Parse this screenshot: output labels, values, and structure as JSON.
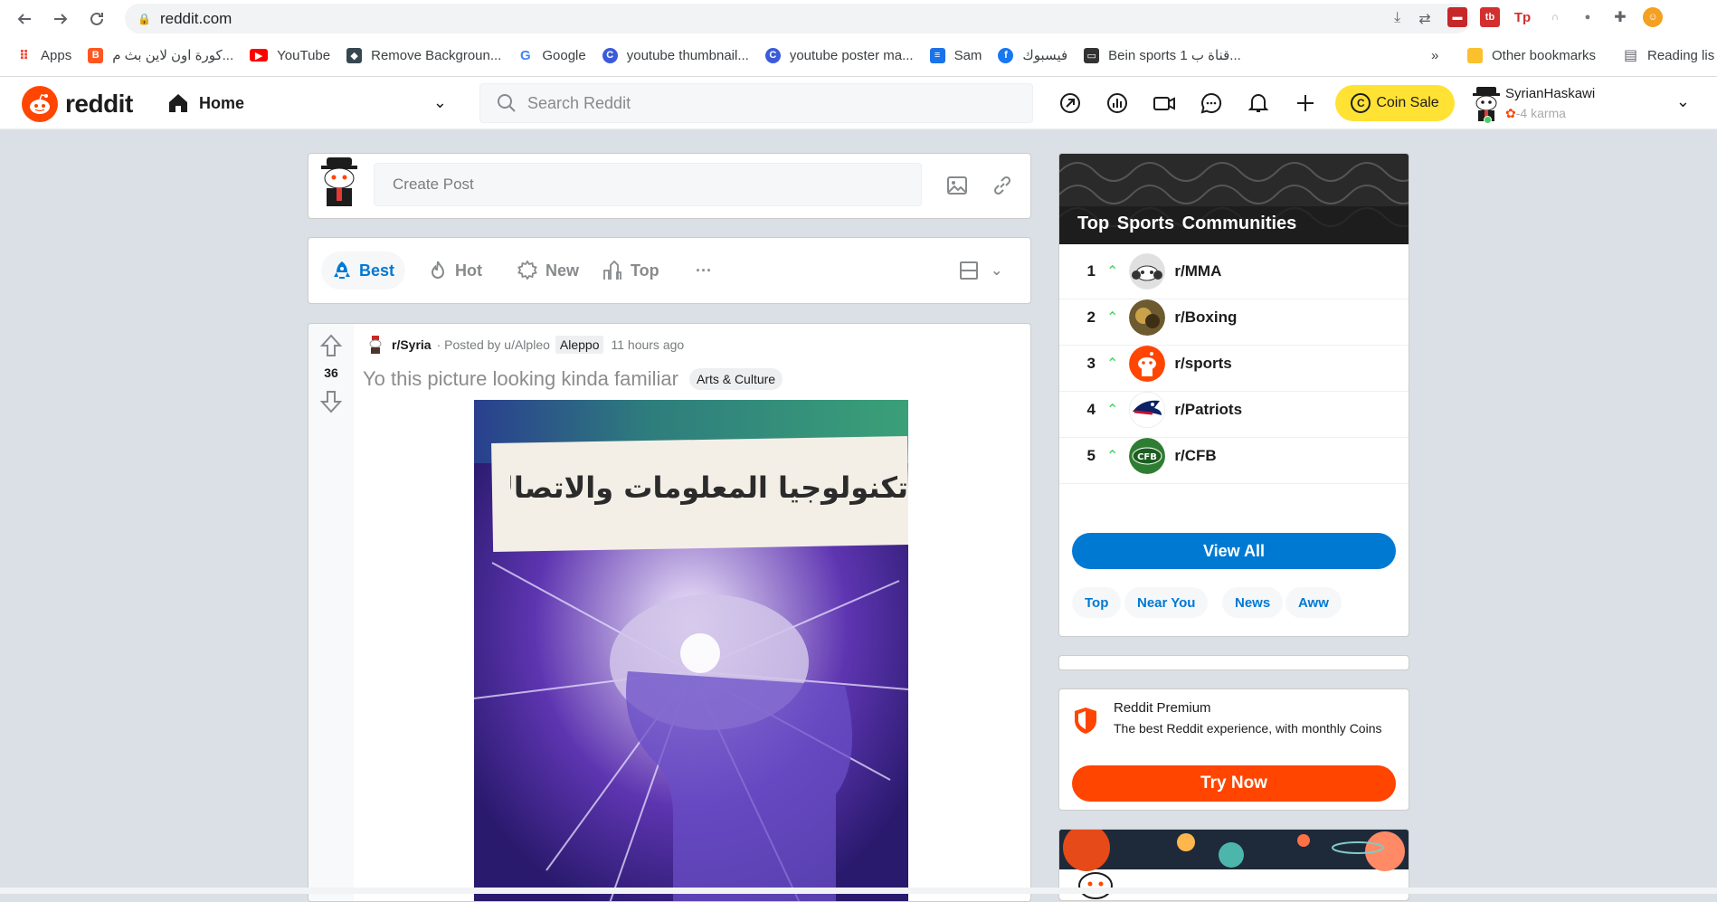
{
  "browser": {
    "url": "reddit.com",
    "bookmarks": [
      {
        "label": "Apps",
        "icon": "apps-grid-icon",
        "color": "#ea4335"
      },
      {
        "label": "كورة اون لاين بث م...",
        "icon": "blogger-icon",
        "color": "#ff5722"
      },
      {
        "label": "YouTube",
        "icon": "youtube-icon",
        "color": "#ff0000"
      },
      {
        "label": "Remove Backgroun...",
        "icon": "removebg-icon",
        "color": "#37474f"
      },
      {
        "label": "Google",
        "icon": "google-icon",
        "color": "#4285f4"
      },
      {
        "label": "youtube thumbnail...",
        "icon": "canva-icon",
        "color": "#3b5bdb"
      },
      {
        "label": "youtube poster ma...",
        "icon": "canva-icon",
        "color": "#3b5bdb"
      },
      {
        "label": "Sam",
        "icon": "page-icon",
        "color": "#1a73e8"
      },
      {
        "label": "فيسبوك",
        "icon": "facebook-icon",
        "color": "#1877f2"
      },
      {
        "label": "Bein sports 1 قناة ب...",
        "icon": "tv-icon",
        "color": "#333333"
      }
    ],
    "other_bookmarks": "Other bookmarks",
    "reading_list": "Reading lis",
    "more_chevron": "»"
  },
  "header": {
    "logo_text": "reddit",
    "home_label": "Home",
    "search_placeholder": "Search Reddit",
    "coin_sale": "Coin Sale",
    "coin_symbol": "C",
    "username": "SyrianHaskawi",
    "karma": "-4 karma"
  },
  "create_post": {
    "placeholder": "Create Post"
  },
  "sort": {
    "best": "Best",
    "hot": "Hot",
    "new": "New",
    "top": "Top",
    "more": "···"
  },
  "post": {
    "votes": "36",
    "subreddit": "r/Syria",
    "posted_by": "· Posted by u/Alpleo",
    "user_flair": "Aleppo",
    "time": "11 hours ago",
    "title": "Yo this picture looking kinda familiar",
    "flair": "Arts & Culture",
    "image_text": "تكنولوجيا المعلومات والاتصالات"
  },
  "sidebar": {
    "title": "Top Sports Communities",
    "communities": [
      {
        "rank": "1",
        "name": "r/MMA",
        "color": "#e0e0e0"
      },
      {
        "rank": "2",
        "name": "r/Boxing",
        "color": "#6d5a2e"
      },
      {
        "rank": "3",
        "name": "r/sports",
        "color": "#ff4500"
      },
      {
        "rank": "4",
        "name": "r/Patriots",
        "color": "#0b2265"
      },
      {
        "rank": "5",
        "name": "r/CFB",
        "color": "#2e7d32"
      }
    ],
    "view_all": "View All",
    "pills": [
      "Top",
      "Near You",
      "News",
      "Aww"
    ]
  },
  "premium": {
    "title": "Reddit Premium",
    "description": "The best Reddit experience, with monthly Coins",
    "button": "Try Now"
  }
}
